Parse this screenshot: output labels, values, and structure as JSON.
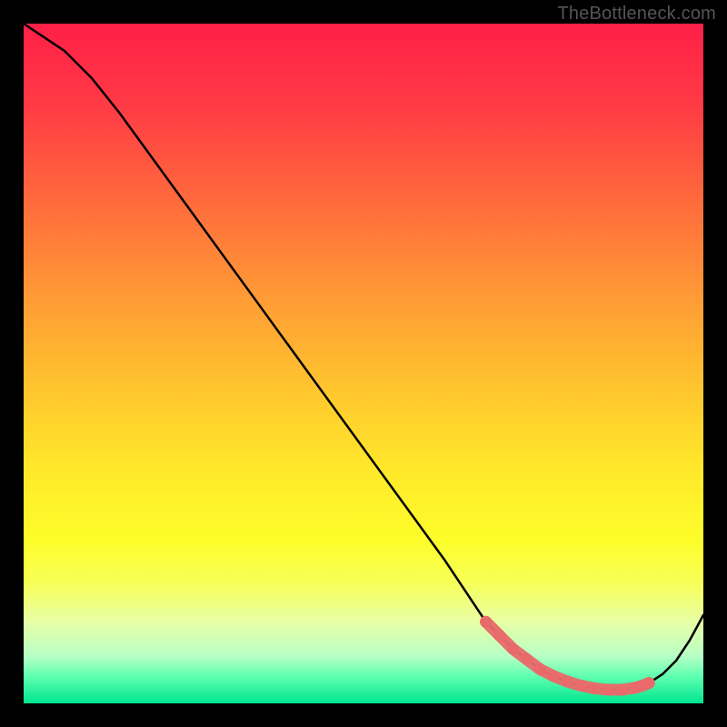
{
  "watermark": "TheBottleneck.com",
  "colors": {
    "page_bg": "#000000",
    "curve": "#000000",
    "highlight": "#e96a6a",
    "gradient_top": "#ff1f47",
    "gradient_bottom": "#00e58f"
  },
  "chart_data": {
    "type": "line",
    "title": "",
    "xlabel": "",
    "ylabel": "",
    "xlim": [
      0,
      100
    ],
    "ylim": [
      0,
      100
    ],
    "grid": false,
    "legend": false,
    "series": [
      {
        "name": "curve",
        "x": [
          0,
          3,
          6,
          10,
          14,
          18,
          22,
          26,
          30,
          34,
          38,
          42,
          46,
          50,
          54,
          58,
          62,
          66,
          68,
          70,
          72,
          74,
          76,
          78,
          80,
          82,
          84,
          86,
          88,
          90,
          92,
          94,
          96,
          98,
          100
        ],
        "values": [
          100,
          98,
          96,
          92,
          87,
          81.5,
          76,
          70.5,
          65,
          59.5,
          54,
          48.5,
          43,
          37.5,
          32,
          26.5,
          21,
          15,
          12,
          10,
          8,
          6.5,
          5,
          4,
          3.2,
          2.6,
          2.2,
          2,
          2,
          2.3,
          3,
          4.3,
          6.3,
          9.3,
          13
        ],
        "color": "#000000"
      }
    ],
    "highlight": {
      "name": "marker-band",
      "color": "#e96a6a",
      "x": [
        68,
        70,
        72,
        74,
        76,
        78,
        80,
        82,
        84,
        86,
        88,
        90,
        91,
        92
      ],
      "values": [
        12,
        10,
        8,
        6.5,
        5,
        4,
        3.2,
        2.6,
        2.2,
        2,
        2,
        2.3,
        2.6,
        3
      ]
    }
  }
}
